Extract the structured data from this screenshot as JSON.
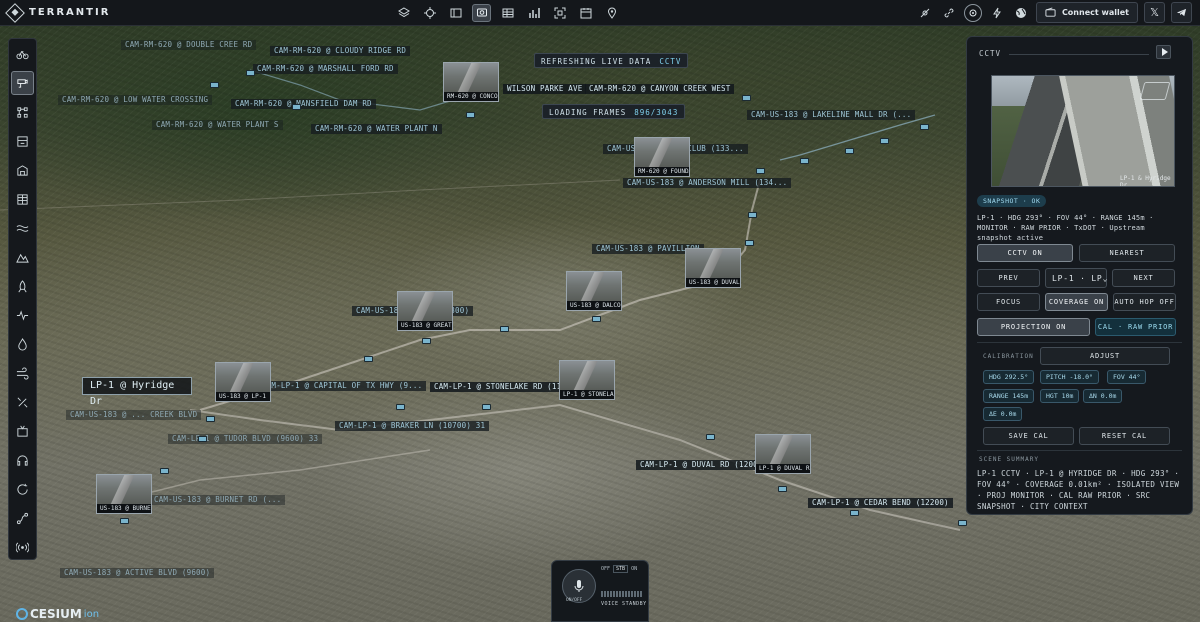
{
  "app": {
    "name": "TERRANTIR"
  },
  "topbar": {
    "center_icons": [
      "layers-icon",
      "crosshair-icon",
      "panel-icon",
      "cctv-icon",
      "grid-icon",
      "bar-chart-icon",
      "scan-icon",
      "calendar-icon",
      "pin-icon"
    ],
    "active_center": "cctv-icon",
    "connect_label": "Connect wallet",
    "x_label": "𝕏"
  },
  "hud": {
    "refresh_label": "REFRESHING LIVE DATA",
    "refresh_tag": "CCTV",
    "loading_label": "LOADING FRAMES",
    "loading_count": "896/3043"
  },
  "map_labels": [
    "CAM-RM-620 @ DOUBLE CREE RD",
    "CAM-RM-620 @ CLOUDY RIDGE RD",
    "CAM-RM-620 @ MARSHALL FORD RD",
    "CAM-RM-620 @ LOW WATER CROSSING",
    "CAM-RM-620 @ MANSFIELD DAM RD",
    "CAM-RM-620 @ WATER PLANT S",
    "CAM-RM-620 @ WATER PLANT N",
    "WILSON PARKE AVE",
    "CAM-RM-620 @ CANYON CREEK WEST",
    "CAM-US-183 @ LAKELINE MALL DR (...",
    "CAM-US-183 @ ... CLUB (133...",
    "CAM-US-183 @ ANDERSON MILL (134...",
    "CAM-US-183 @ PAVILLION",
    "CAM-US-183 @ ... (10800)",
    "CAM-LP-1 @ CAPITAL OF TX HWY (9...",
    "CAM-LP-1 @ STONELAKE RD (11200)",
    "CAM-US-183 @ ... CREEK BLVD",
    "CAM-LP-1 @ BRAKER LN (10700) 31",
    "CAM-LP-1 @ TUDOR BLVD (9600) 33",
    "CAM-LP-1 @ DUVAL RD (12000)",
    "CAM-US-183 @ BURNET RD (...",
    "CAM-LP-1 @ CEDAR BEND (12200)",
    "CAM-US-183 @ ACTIVE BLVD (9600)"
  ],
  "thumbs": [
    "RM-620 @ CONCOR",
    "RM-620 @ FOUNDA",
    "US-183 @ DUVAL",
    "US-183 @ DALCON",
    "US-183 @ GREAT",
    "US-183 @ LP-1 N",
    "LP-1 @ STONELAK",
    "LP-1 @ DUVAL RD",
    "US-183 @ BURNET"
  ],
  "focus_label": "LP-1 @ Hyridge Dr",
  "panel": {
    "title": "CCTV",
    "feed_caption": "LP-1 & Hyridge Dr",
    "badge": "SNAPSHOT · OK",
    "info": "LP-1 · HDG 293° · FOV 44° · RANGE 145m · MONITOR · RAW PRIOR · TxDOT · Upstream snapshot active",
    "buttons": {
      "cctv_on": "CCTV ON",
      "nearest": "NEAREST",
      "prev": "PREV",
      "camera_select": "LP-1 · LP",
      "next": "NEXT",
      "focus": "FOCUS",
      "coverage_on": "COVERAGE ON",
      "auto_hop": "AUTO HOP OFF",
      "projection_on": "PROJECTION ON",
      "cal_raw_prior": "CAL · RAW PRIOR"
    },
    "calibration": {
      "section": "CALIBRATION",
      "adjust": "ADJUST",
      "hdg": "HDG 292.5°",
      "pitch": "PITCH -18.0°",
      "fov": "FOV 44°",
      "range": "RANGE 145m",
      "hgt": "HGT 10m",
      "dn": "ΔN 0.0m",
      "de": "ΔE 0.0m",
      "save": "SAVE CAL",
      "reset": "RESET CAL"
    },
    "scene_section": "SCENE SUMMARY",
    "scene_summary": "LP-1 CCTV · LP-1 @ HYRIDGE DR · HDG 293° · FOV 44° · COVERAGE 0.01km² · ISOLATED VIEW · PROJ MONITOR · CAL RAW PRIOR · SRC SNAPSHOT · CITY CONTEXT"
  },
  "voice": {
    "button": "ON/OFF",
    "off": "OFF",
    "stb": "STB",
    "on": "ON",
    "status": "VOICE STANDBY"
  },
  "attribution": {
    "brand": "CESIUM",
    "suffix": "ion"
  }
}
